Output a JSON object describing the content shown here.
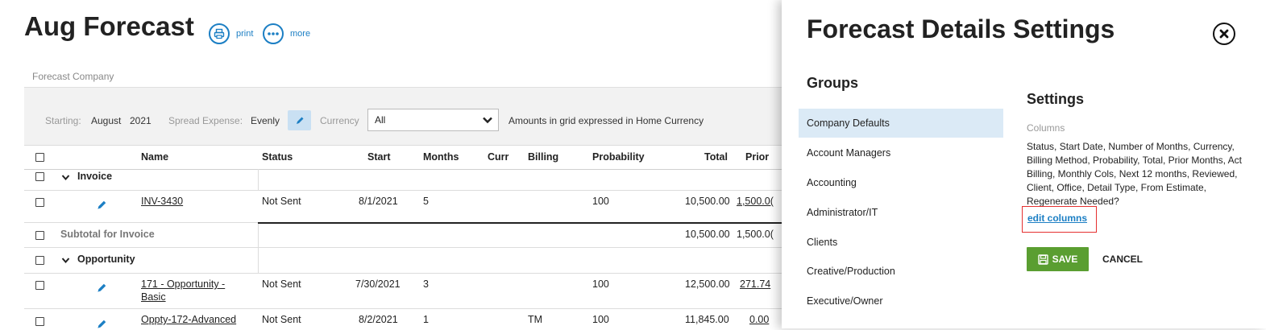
{
  "page": {
    "title": "Aug Forecast",
    "print_label": "print",
    "more_label": "more",
    "breadcrumb": "Forecast Company"
  },
  "filters": {
    "starting_label": "Starting:",
    "starting_month": "August",
    "starting_year": "2021",
    "spread_label": "Spread Expense:",
    "spread_value": "Evenly",
    "currency_label": "Currency",
    "currency_value": "All",
    "note": "Amounts in grid expressed in Home Currency"
  },
  "table": {
    "headers": {
      "name": "Name",
      "status": "Status",
      "start": "Start",
      "months": "Months",
      "curr": "Curr",
      "billing": "Billing",
      "probability": "Probability",
      "total": "Total",
      "prior": "Prior"
    },
    "group_invoice": "Invoice",
    "row_inv": {
      "name": "INV-3430",
      "status": "Not Sent",
      "start": "8/1/2021",
      "months": "5",
      "probability": "100",
      "total": "10,500.00",
      "prior": "1,500.0("
    },
    "subtotal": {
      "label": "Subtotal for Invoice",
      "total": "10,500.00",
      "prior": "1,500.0("
    },
    "group_opportunity": "Opportunity",
    "row_opp1": {
      "name_line1": "171 - Opportunity -",
      "name_line2": "Basic",
      "status": "Not Sent",
      "start": "7/30/2021",
      "months": "3",
      "probability": "100",
      "total": "12,500.00",
      "prior": "271.74"
    },
    "row_opp2": {
      "name": "Oppty-172-Advanced",
      "status": "Not Sent",
      "start": "8/2/2021",
      "months": "1",
      "billing": "TM",
      "probability": "100",
      "total": "11,845.00",
      "prior": "0.00"
    }
  },
  "panel": {
    "title": "Forecast Details Settings",
    "groups_heading": "Groups",
    "groups": [
      "Company Defaults",
      "Account Managers",
      "Accounting",
      "Administrator/IT",
      "Clients",
      "Creative/Production",
      "Executive/Owner"
    ],
    "settings_heading": "Settings",
    "columns_label": "Columns",
    "columns_text": "Status, Start Date, Number of Months, Currency, Billing Method, Probability, Total, Prior Months, Act Billing, Monthly Cols, Next 12 months, Reviewed, Client, Office, Detail Type, From Estimate, Regenerate Needed?",
    "edit_columns": "edit columns",
    "save_label": "SAVE",
    "cancel_label": "CANCEL"
  },
  "colors": {
    "accent": "#1c7fc4",
    "save_green": "#5a9e31",
    "highlight_red": "#e53030",
    "selected_group": "#dbeaf6"
  },
  "icons": [
    "print-icon",
    "more-icon",
    "pencil-icon",
    "chevron-down-icon",
    "close-icon",
    "save-icon",
    "checkbox-icon"
  ]
}
